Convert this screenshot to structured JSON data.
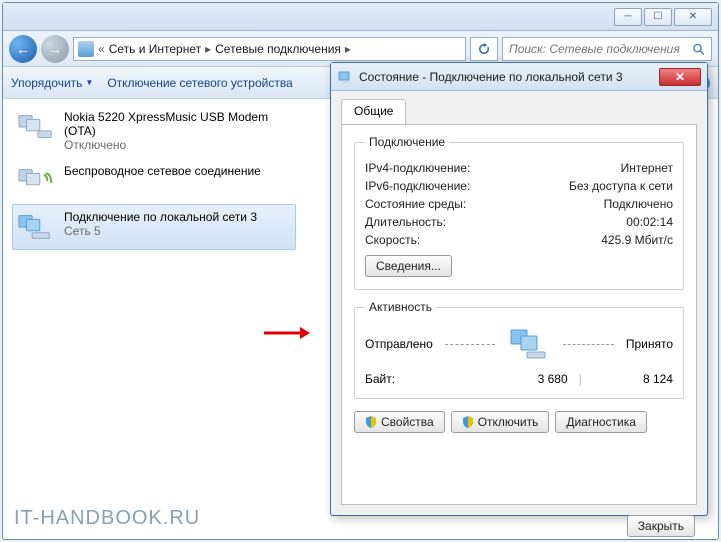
{
  "breadcrumb": {
    "seg1": "Сеть и Интернет",
    "seg2": "Сетевые подключения"
  },
  "search": {
    "placeholder": "Поиск: Сетевые подключения"
  },
  "toolbar": {
    "organize": "Упорядочить",
    "disable": "Отключение сетевого устройства"
  },
  "netlist": [
    {
      "title": "Nokia 5220 XpressMusic USB Modem (OTA)",
      "sub": "Отключено"
    },
    {
      "title": "Беспроводное сетевое соединение",
      "sub": ""
    },
    {
      "title": "Подключение по локальной сети 3",
      "sub": "Сеть 5"
    }
  ],
  "dialog": {
    "title": "Состояние - Подключение по локальной сети 3",
    "tab": "Общие",
    "group_conn": "Подключение",
    "rows": {
      "ipv4_l": "IPv4-подключение:",
      "ipv4_v": "Интернет",
      "ipv6_l": "IPv6-подключение:",
      "ipv6_v": "Без доступа к сети",
      "media_l": "Состояние среды:",
      "media_v": "Подключено",
      "dur_l": "Длительность:",
      "dur_v": "00:02:14",
      "spd_l": "Скорость:",
      "spd_v": "425.9 Мбит/с"
    },
    "details_btn": "Сведения...",
    "group_act": "Активность",
    "sent": "Отправлено",
    "recv": "Принято",
    "bytes_l": "Байт:",
    "bytes_sent": "3 680",
    "bytes_recv": "8 124",
    "props_btn": "Свойства",
    "disable_btn": "Отключить",
    "diag_btn": "Диагностика",
    "close_btn": "Закрыть"
  },
  "watermark": "IT-HANDBOOK.RU"
}
